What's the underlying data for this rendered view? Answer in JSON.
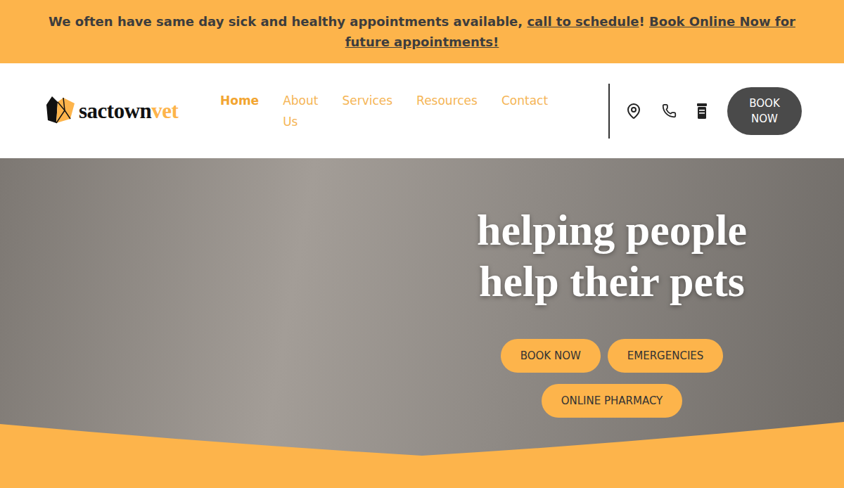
{
  "banner": {
    "text": "We often have same day sick and healthy appointments available, ",
    "call_link": "call to schedule",
    "separator": "! ",
    "book_link": "Book Online Now for future appointments!"
  },
  "logo": {
    "prefix": "sactown",
    "suffix": "vet"
  },
  "nav": [
    {
      "label": "Home",
      "selected": true
    },
    {
      "label": "About Us",
      "selected": false
    },
    {
      "label": "Services",
      "selected": false
    },
    {
      "label": "Resources",
      "selected": false
    },
    {
      "label": "Contact",
      "selected": false
    }
  ],
  "header_button": "BOOK NOW",
  "hero": {
    "title_lines": [
      "helping people",
      "help their pets"
    ],
    "buttons": [
      "BOOK NOW",
      "EMERGENCIES",
      "ONLINE PHARMACY"
    ]
  }
}
